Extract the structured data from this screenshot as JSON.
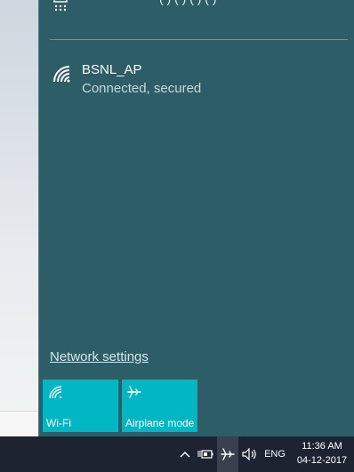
{
  "flyout": {
    "clipped_header_text": "( ) ( ) ( ) ( )",
    "network": {
      "name": "BSNL_AP",
      "status": "Connected, secured"
    },
    "settings_link": "Network settings",
    "tiles": [
      {
        "label": "Wi-Fi",
        "icon": "wifi-icon"
      },
      {
        "label": "Airplane mode",
        "icon": "airplane-icon"
      }
    ]
  },
  "taskbar": {
    "language": "ENG",
    "time": "11:36 AM",
    "date": "04-12-2017"
  },
  "colors": {
    "flyout_bg": "#2d5d66",
    "tile_accent": "#00b7c3",
    "taskbar_bg": "#1d2330"
  }
}
